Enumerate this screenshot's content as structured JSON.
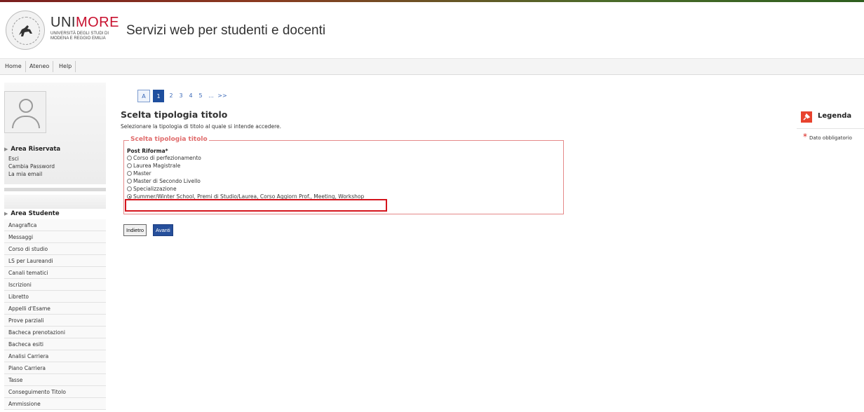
{
  "header": {
    "brand_prefix": "UNI",
    "brand_suffix": "MORE",
    "brand_sub_line1": "UNIVERSITÀ DEGLI STUDI DI",
    "brand_sub_line2": "MODENA E REGGIO EMILIA",
    "site_title": "Servizi web per studenti e docenti",
    "brand_color": "#c8102e"
  },
  "nav": {
    "items": [
      "Home",
      "Ateneo",
      "Help"
    ]
  },
  "sidebar": {
    "reserved_title": "Area Riservata",
    "reserved_links": [
      "Esci",
      "Cambia Password",
      "La mia email"
    ],
    "student_title": "Area Studente",
    "student_links": [
      "Anagrafica",
      "Messaggi",
      "Corso di studio",
      "LS per Laureandi",
      "Canali tematici",
      "Iscrizioni",
      "Libretto",
      "Appelli d'Esame",
      "Prove parziali",
      "Bacheca prenotazioni",
      "Bacheca esiti",
      "Analisi Carriera",
      "Piano Carriera",
      "Tasse",
      "Conseguimento Titolo",
      "Ammissione"
    ]
  },
  "main": {
    "pager": [
      "A",
      "1",
      "2",
      "3",
      "4",
      "5",
      "...",
      ">>"
    ],
    "pager_active": "1",
    "title": "Scelta tipologia titolo",
    "description": "Selezionare la tipologia di titolo al quale si intende accedere.",
    "fieldset_legend": "Scelta tipologia titolo",
    "group_label": "Post Riforma*",
    "options": [
      "Corso di perfezionamento",
      "Laurea Magistrale",
      "Master",
      "Master di Secondo Livello",
      "Specializzazione",
      "Summer/Winter School, Premi di Studio/Laurea, Corso Aggiorn Prof., Meeting, Workshop"
    ],
    "selected_option": "Summer/Winter School, Premi di Studio/Laurea, Corso Aggiorn Prof., Meeting, Workshop",
    "back_label": "Indietro",
    "next_label": "Avanti",
    "accent_color": "#264f9b",
    "highlight_color": "#d4141c"
  },
  "legend_panel": {
    "title": "Legenda",
    "required_text": "Dato obbligatorio",
    "required_symbol": "*"
  }
}
